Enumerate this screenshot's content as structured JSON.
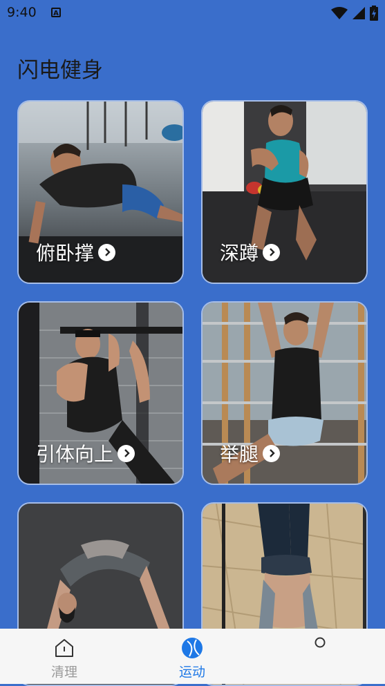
{
  "status": {
    "time": "9:40",
    "app_badge": "A"
  },
  "title": "闪电健身",
  "cards": [
    {
      "label": "俯卧撑"
    },
    {
      "label": "深蹲"
    },
    {
      "label": "引体向上"
    },
    {
      "label": "举腿"
    },
    {
      "label": ""
    },
    {
      "label": ""
    }
  ],
  "tabs": [
    {
      "label": "清理",
      "color": "#9a9a9a"
    },
    {
      "label": "运动",
      "color": "#1e78e6"
    },
    {
      "label": ""
    }
  ],
  "colors": {
    "background": "#3a6ecb",
    "tab_active": "#1e78e6",
    "tab_inactive": "#9a9a9a"
  }
}
